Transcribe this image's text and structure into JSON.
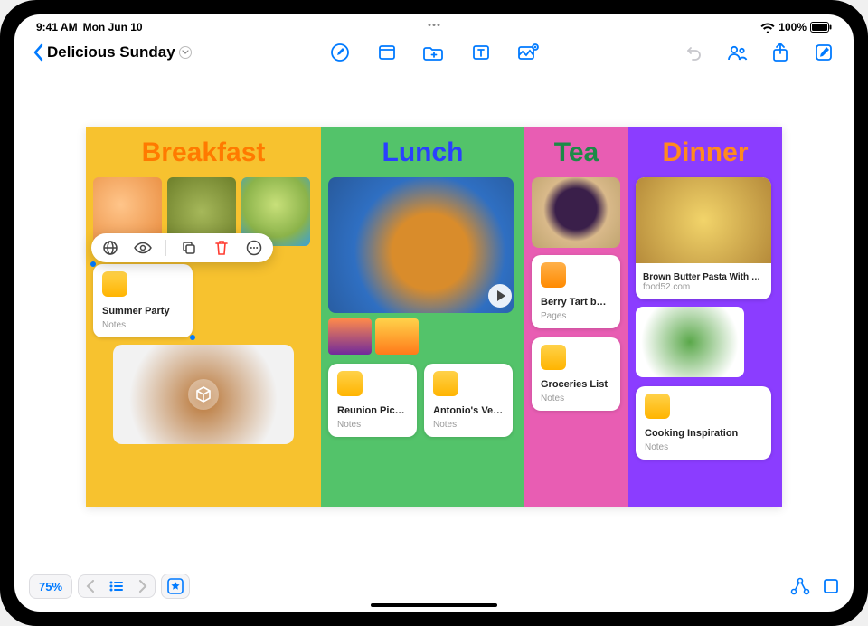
{
  "status": {
    "time": "9:41 AM",
    "date": "Mon Jun 10",
    "battery": "100%"
  },
  "nav": {
    "back": "",
    "title": "Delicious Sunday"
  },
  "columns": {
    "breakfast": {
      "heading": "Breakfast"
    },
    "lunch": {
      "heading": "Lunch"
    },
    "tea": {
      "heading": "Tea"
    },
    "dinner": {
      "heading": "Dinner"
    }
  },
  "cards": {
    "summerParty": {
      "title": "Summer Party",
      "sub": "Notes"
    },
    "reunionPicnic": {
      "title": "Reunion Picnic",
      "sub": "Notes"
    },
    "antonioTacos": {
      "title": "Antonio's Vegan Tacos",
      "sub": "Notes"
    },
    "berryTart": {
      "title": "Berry Tart by Olivia",
      "sub": "Pages"
    },
    "groceries": {
      "title": "Groceries List",
      "sub": "Notes"
    },
    "pastaLink": {
      "title": "Brown Butter Pasta With But…",
      "sub": "food52.com"
    },
    "cooking": {
      "title": "Cooking Inspiration",
      "sub": "Notes"
    }
  },
  "bottom": {
    "zoom": "75%"
  },
  "colors": {
    "accent": "#007aff",
    "breakfastBg": "#f7c22f",
    "lunchBg": "#53c36a",
    "teaBg": "#e85db3",
    "dinnerBg": "#8b3dff"
  }
}
